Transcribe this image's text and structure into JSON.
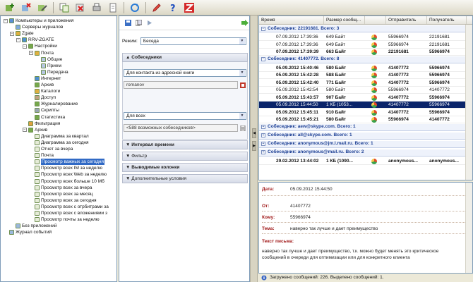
{
  "tree": {
    "items": [
      {
        "label": "Компьютеры и приложения",
        "level": 0
      },
      {
        "label": "Серверы журналов",
        "level": 1
      },
      {
        "label": "Zgate",
        "level": 1
      },
      {
        "label": "RRV-ZGATE",
        "level": 2
      },
      {
        "label": "Настройки",
        "level": 3
      },
      {
        "label": "Почта",
        "level": 4
      },
      {
        "label": "Общие",
        "level": 5
      },
      {
        "label": "Прием",
        "level": 5
      },
      {
        "label": "Передача",
        "level": 5
      },
      {
        "label": "Интернет",
        "level": 4
      },
      {
        "label": "Архив",
        "level": 4
      },
      {
        "label": "Каталоги",
        "level": 4
      },
      {
        "label": "Доступ",
        "level": 4
      },
      {
        "label": "Журналирование",
        "level": 4
      },
      {
        "label": "Скрипты",
        "level": 4
      },
      {
        "label": "Статистика",
        "level": 4
      },
      {
        "label": "Фильтрация",
        "level": 3
      },
      {
        "label": "Архив",
        "level": 3
      },
      {
        "label": "Диаграмма за квартал",
        "level": 4
      },
      {
        "label": "Диаграмма за сегодня",
        "level": 4
      },
      {
        "label": "Отчет за вчера",
        "level": 4
      },
      {
        "label": "Почта",
        "level": 4
      },
      {
        "label": "Просмотр важных за сегодня",
        "level": 4,
        "selected": true
      },
      {
        "label": "Просмотр всех IM за неделю",
        "level": 4
      },
      {
        "label": "Просмотр всех Web за неделю",
        "level": 4
      },
      {
        "label": "Просмотр всех больше 10 Мб",
        "level": 4
      },
      {
        "label": "Просмотр всех за вчера",
        "level": 4
      },
      {
        "label": "Просмотр всех за месяц",
        "level": 4
      },
      {
        "label": "Просмотр всех за сегодня",
        "level": 4
      },
      {
        "label": "Просмотр всех с отрбитрами за",
        "level": 4
      },
      {
        "label": "Просмотр всех с вложениями з",
        "level": 4
      },
      {
        "label": "Просмотр почты за неделю",
        "level": 4
      },
      {
        "label": "Без приложений",
        "level": 1
      },
      {
        "label": "Журнал событий",
        "level": 0
      }
    ]
  },
  "filter": {
    "mode_label": "Режим:",
    "mode_value": "Беседа",
    "section_partners": "Собеседники",
    "contact_source": "Для контакта из адресной книги",
    "contact_name": "romanov",
    "scope": "Для всех",
    "possible_partners": "<588 возможных собеседников>",
    "section_time": "Интервал времени",
    "section_filter": "Фильтр",
    "section_columns": "Выводимые колонки",
    "section_extra": "Дополнительные условия"
  },
  "grid": {
    "columns": [
      "Время",
      "Размер сообщ...",
      "",
      "Отправитель",
      "Получатель"
    ],
    "groups": [
      {
        "label": "Собеседник: 22191681. Всего: 3",
        "rows": [
          {
            "time": "07.09.2012 17:39:36",
            "size": "649 Байт",
            "from": "55966974",
            "to": "22191681",
            "bold": false
          },
          {
            "time": "07.09.2012 17:39:36",
            "size": "649 Байт",
            "from": "55966974",
            "to": "22191681",
            "bold": false
          },
          {
            "time": "07.09.2012 17:39:39",
            "size": "663 Байт",
            "from": "22191681",
            "to": "55966974",
            "bold": true
          }
        ]
      },
      {
        "label": "Собеседник: 41407772. Всего: 8",
        "rows": [
          {
            "time": "05.09.2012 15:40:46",
            "size": "580 Байт",
            "from": "41407772",
            "to": "55966974",
            "bold": true
          },
          {
            "time": "05.09.2012 15:42:28",
            "size": "588 Байт",
            "from": "41407772",
            "to": "55966974",
            "bold": true
          },
          {
            "time": "05.09.2012 15:42:40",
            "size": "771 Байт",
            "from": "41407772",
            "to": "55966974",
            "bold": true
          },
          {
            "time": "05.09.2012 15:42:54",
            "size": "580 Байт",
            "from": "55966974",
            "to": "41407772",
            "bold": false
          },
          {
            "time": "05.09.2012 15:43:57",
            "size": "907 Байт",
            "from": "41407772",
            "to": "55966974",
            "bold": true
          },
          {
            "time": "05.09.2012 15:44:50",
            "size": "1 КБ (1053...",
            "from": "41407772",
            "to": "55966974",
            "bold": false,
            "selected": true
          },
          {
            "time": "05.09.2012 15:45:11",
            "size": "910 Байт",
            "from": "41407772",
            "to": "55966974",
            "bold": true
          },
          {
            "time": "05.09.2012 15:45:21",
            "size": "580 Байт",
            "from": "55966974",
            "to": "41407772",
            "bold": true
          }
        ]
      },
      {
        "label": "Собеседник: aew@skype.com. Всего: 1",
        "rows": []
      },
      {
        "label": "Собеседник: all@skype.com. Всего: 1",
        "rows": []
      },
      {
        "label": "Собеседник: anonymous@jm.l.mail.ru. Всего: 1",
        "rows": []
      },
      {
        "label": "Собеседник: anonymous@mail.ru. Всего: 2",
        "rows": []
      },
      {
        "label": "",
        "rows": [
          {
            "time": "29.02.2012 13:44:02",
            "size": "1 КБ (1090...",
            "from": "anonymous...",
            "to": "anonymous...",
            "bold": true
          }
        ]
      }
    ]
  },
  "detail": {
    "date_label": "Дата:",
    "date_value": "05.09.2012 15:44:50",
    "from_label": "От:",
    "from_value": "41407772",
    "to_label": "Кому:",
    "to_value": "55966974",
    "subject_label": "Тема:",
    "subject_value": "наверно так лучше и дает преимущество",
    "body_label": "Текст письма:",
    "body_value": "наверно так лучше и дает преимущество, т.к. можно будет менять это критическое сообщений в очереди для оптимизации или для конкретного клиента"
  },
  "status": {
    "text": "Загружено сообщений: 226. Выделено сообщений: 1."
  },
  "colors": {
    "selection": "#0a246a",
    "group_text": "#1c3f94",
    "label_red": "#a01818"
  }
}
